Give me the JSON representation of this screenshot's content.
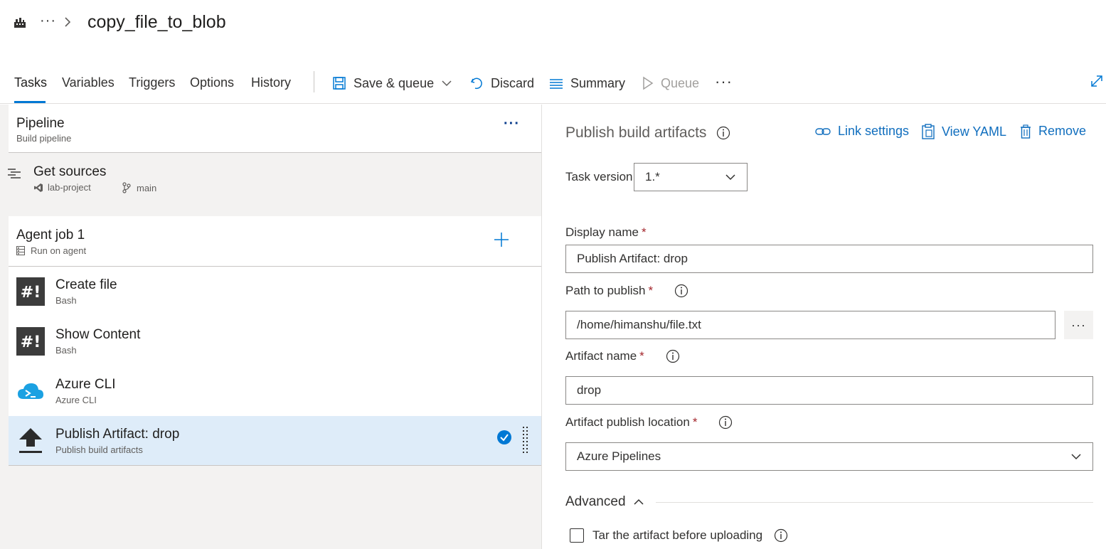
{
  "header": {
    "breadcrumb_more": "···",
    "title": "copy_file_to_blob"
  },
  "toolbar": {
    "tabs": [
      {
        "label": "Tasks",
        "active": true
      },
      {
        "label": "Variables",
        "active": false
      },
      {
        "label": "Triggers",
        "active": false
      },
      {
        "label": "Options",
        "active": false
      },
      {
        "label": "History",
        "active": false
      }
    ],
    "save_queue_label": "Save & queue",
    "discard_label": "Discard",
    "summary_label": "Summary",
    "queue_label": "Queue",
    "more_label": "···"
  },
  "pipeline": {
    "title": "Pipeline",
    "subtitle": "Build pipeline",
    "more_label": "···"
  },
  "sources": {
    "title": "Get sources",
    "repo": "lab-project",
    "branch": "main"
  },
  "job": {
    "title": "Agent job 1",
    "subtitle": "Run on agent"
  },
  "tasks": [
    {
      "title": "Create file",
      "subtitle": "Bash",
      "icon": "bash-icon"
    },
    {
      "title": "Show Content",
      "subtitle": "Bash",
      "icon": "bash-icon"
    },
    {
      "title": "Azure CLI",
      "subtitle": "Azure CLI",
      "icon": "azure-cli-icon"
    },
    {
      "title": "Publish Artifact: drop",
      "subtitle": "Publish build artifacts",
      "icon": "upload-icon",
      "selected": true
    }
  ],
  "details": {
    "title": "Publish build artifacts",
    "link_settings": "Link settings",
    "view_yaml": "View YAML",
    "remove": "Remove",
    "task_version_label": "Task version",
    "task_version_value": "1.*",
    "display_name_label": "Display name",
    "display_name_value": "Publish Artifact: drop",
    "path_label": "Path to publish",
    "path_value": "/home/himanshu/file.txt",
    "browse_label": "···",
    "artifact_name_label": "Artifact name",
    "artifact_name_value": "drop",
    "location_label": "Artifact publish location",
    "location_value": "Azure Pipelines",
    "required_mark": "*",
    "advanced_label": "Advanced",
    "tar_label": "Tar the artifact before uploading"
  },
  "colors": {
    "accent": "#0078d4",
    "link": "#106ebe",
    "selected_row": "#deecf9",
    "required": "#a4262c"
  }
}
